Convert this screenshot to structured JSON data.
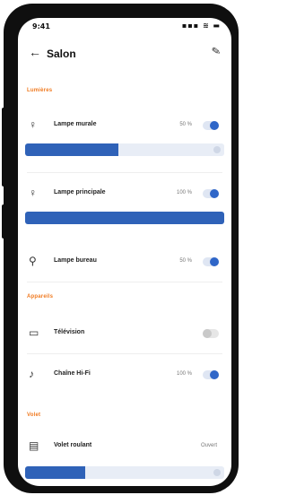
{
  "status": {
    "time": "9:41",
    "icons": "▪▪▪ ≋ ▬"
  },
  "header": {
    "back_icon": "←",
    "title": "Salon",
    "edit_icon": "✎"
  },
  "sections": {
    "lights": "Lumières",
    "devices": "Appareils",
    "blinds": "Volet"
  },
  "devices": [
    {
      "name": "Lampe murale",
      "icon": "lightbulb-icon",
      "glyph": "♀",
      "value": "50 %",
      "on": true,
      "level": 0.47
    },
    {
      "name": "Lampe principale",
      "icon": "lightbulb-icon",
      "glyph": "♀",
      "value": "100 %",
      "on": true,
      "level": 1.0
    },
    {
      "name": "Lampe bureau",
      "icon": "desk-lamp-icon",
      "glyph": "⚲",
      "value": "50 %",
      "on": true
    },
    {
      "name": "Télévision",
      "icon": "tv-icon",
      "glyph": "▭",
      "on": false
    },
    {
      "name": "Chaîne Hi-Fi",
      "icon": "speaker-icon",
      "glyph": "♪",
      "value": "100 %",
      "on": true
    },
    {
      "name": "Volet roulant",
      "icon": "shutter-icon",
      "glyph": "▤",
      "status": "Ouvert",
      "level": 0.3
    }
  ],
  "colors": {
    "accent": "#2f62b8",
    "section": "#f07a20"
  }
}
